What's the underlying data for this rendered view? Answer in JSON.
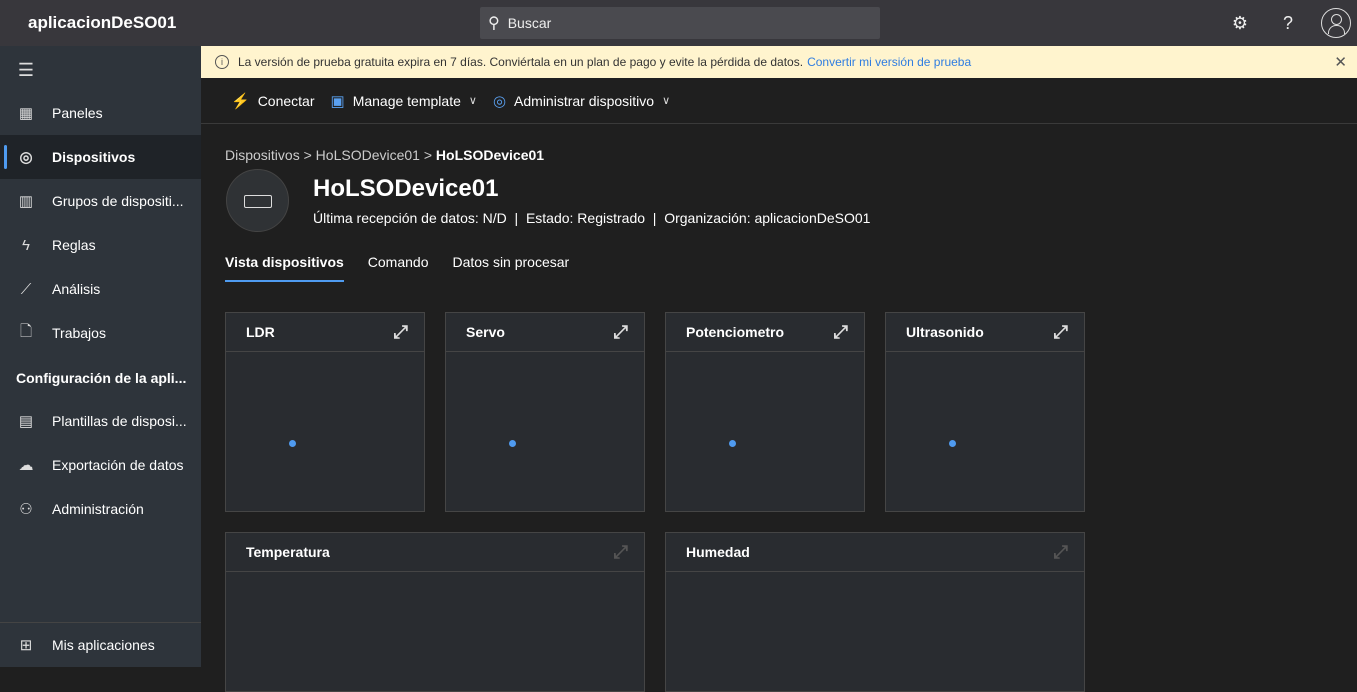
{
  "app": {
    "title": "aplicacionDeSO01",
    "search_placeholder": "Buscar"
  },
  "sidebar": {
    "items": [
      {
        "label": "Paneles",
        "icon": "dashboard-icon"
      },
      {
        "label": "Dispositivos",
        "icon": "devices-icon",
        "active": true
      },
      {
        "label": "Grupos de dispositi...",
        "icon": "device-groups-icon"
      },
      {
        "label": "Reglas",
        "icon": "rules-icon"
      },
      {
        "label": "Análisis",
        "icon": "analytics-icon"
      },
      {
        "label": "Trabajos",
        "icon": "jobs-icon"
      }
    ],
    "section": "Configuración de la apli...",
    "config_items": [
      {
        "label": "Plantillas de disposi...",
        "icon": "templates-icon"
      },
      {
        "label": "Exportación de datos",
        "icon": "export-icon"
      },
      {
        "label": "Administración",
        "icon": "admin-icon"
      }
    ],
    "bottom": "Mis aplicaciones"
  },
  "banner": {
    "text": "La versión de prueba gratuita expira en 7 días. Conviértala en un plan de pago y evite la pérdida de datos.",
    "link": "Convertir mi versión de prueba"
  },
  "commands": {
    "connect": "Conectar",
    "template": "Manage template",
    "manage": "Administrar dispositivo"
  },
  "breadcrumb": {
    "root": "Dispositivos",
    "parent": "HoLSODevice01",
    "current": "HoLSODevice01"
  },
  "device": {
    "name": "HoLSODevice01",
    "meta": "Última recepción de datos: N/D  |  Estado: Registrado  |  Organización: aplicacionDeSO01"
  },
  "tabs": [
    "Vista dispositivos",
    "Comando",
    "Datos sin procesar"
  ],
  "tiles": [
    "LDR",
    "Servo",
    "Potenciometro",
    "Ultrasonido",
    "Temperatura",
    "Humedad"
  ],
  "colors": {
    "accent": "#4f9bf0",
    "banner": "#fff4ce"
  }
}
